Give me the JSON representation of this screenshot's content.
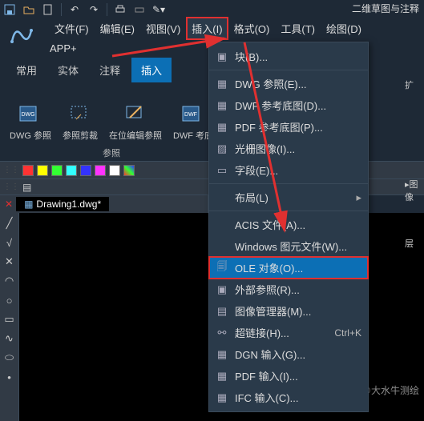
{
  "workspace_label": "二维草图与注释",
  "menubar": [
    "文件(F)",
    "编辑(E)",
    "视图(V)",
    "插入(I)",
    "格式(O)",
    "工具(T)",
    "绘图(D)"
  ],
  "menubar_active_index": 3,
  "app_plus": "APP+",
  "tabs": [
    "常用",
    "实体",
    "注释",
    "插入"
  ],
  "tab_active_index": 3,
  "ribbon": {
    "group_label": "参照",
    "buttons": [
      "DWG 参照",
      "参照剪裁",
      "在位编辑参照",
      "DWF 考底"
    ]
  },
  "worktab": "Drawing1.dwg*",
  "dropdown": {
    "header": "块(B)...",
    "items": [
      {
        "label": "DWG 参照(E)..."
      },
      {
        "label": "DWF 参考底图(D)..."
      },
      {
        "label": "PDF 参考底图(P)..."
      },
      {
        "label": "光栅图像(I)..."
      },
      {
        "label": "字段(E)..."
      }
    ],
    "group2": [
      {
        "label": "布局(L)"
      },
      {
        "label": "ACIS 文件(A)..."
      },
      {
        "label": "Windows 图元文件(W)..."
      },
      {
        "label": "OLE 对象(O)...",
        "highlight": true
      },
      {
        "label": "外部参照(R)..."
      },
      {
        "label": "图像管理器(M)..."
      },
      {
        "label": "超链接(H)...",
        "shortcut": "Ctrl+K"
      },
      {
        "label": "DGN 输入(G)..."
      },
      {
        "label": "PDF 输入(I)..."
      },
      {
        "label": "IFC 输入(C)..."
      }
    ]
  },
  "right_edge": [
    "扩",
    "▸图像",
    "层"
  ],
  "watermark": "搜狐号 @大水牛测绘"
}
